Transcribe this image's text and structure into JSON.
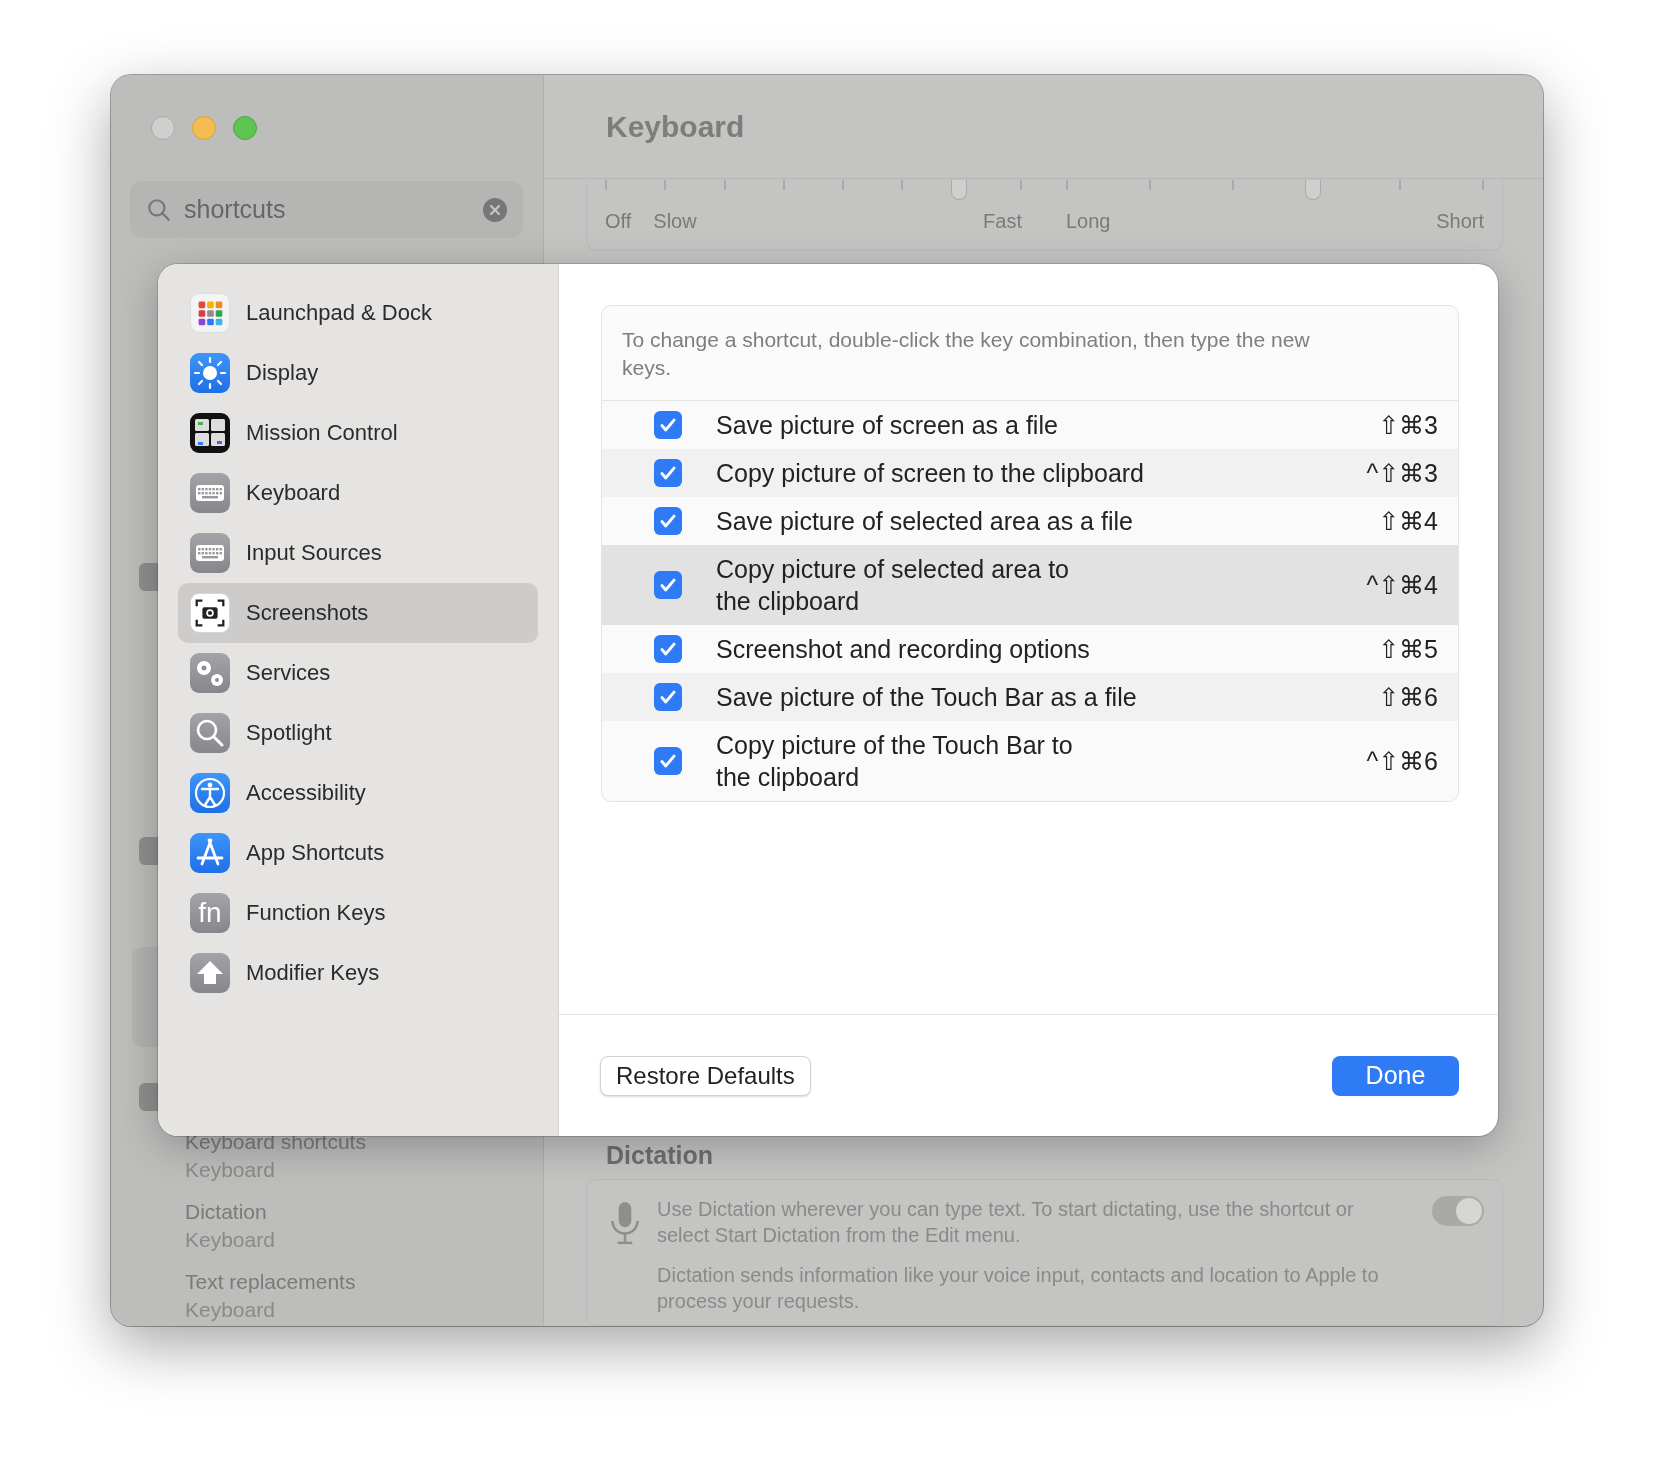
{
  "window": {
    "title": "Keyboard",
    "search": {
      "value": "shortcuts"
    },
    "sliders": [
      {
        "level": 0.85,
        "labels": [
          "Off",
          "Slow",
          "Fast"
        ]
      },
      {
        "level": 0.59,
        "labels": [
          "Long",
          "Short"
        ]
      }
    ],
    "results": [
      {
        "title": "Keyboard shortcuts",
        "subtitle": "Keyboard"
      },
      {
        "title": "Dictation",
        "subtitle": "Keyboard"
      },
      {
        "title": "Text replacements",
        "subtitle": "Keyboard"
      }
    ],
    "dictation": {
      "heading": "Dictation",
      "text": "Use Dictation wherever you can type text. To start dictating, use the shortcut or select Start Dictation from the Edit menu.",
      "note": "Dictation sends information like your voice input, contacts and location to Apple to process your requests.",
      "on": true
    }
  },
  "sheet": {
    "sidebar": [
      {
        "label": "Launchpad & Dock",
        "selected": false
      },
      {
        "label": "Display",
        "selected": false
      },
      {
        "label": "Mission Control",
        "selected": false
      },
      {
        "label": "Keyboard",
        "selected": false
      },
      {
        "label": "Input Sources",
        "selected": false
      },
      {
        "label": "Screenshots",
        "selected": true
      },
      {
        "label": "Services",
        "selected": false
      },
      {
        "label": "Spotlight",
        "selected": false
      },
      {
        "label": "Accessibility",
        "selected": false
      },
      {
        "label": "App Shortcuts",
        "selected": false
      },
      {
        "label": "Function Keys",
        "selected": false,
        "icon_text": "fn"
      },
      {
        "label": "Modifier Keys",
        "selected": false
      }
    ],
    "hint": "To change a shortcut, double-click the key combination, then type the new keys.",
    "shortcuts": [
      {
        "label": "Save picture of screen as a file",
        "keys": "⇧⌘3",
        "checked": true,
        "selected": false
      },
      {
        "label": "Copy picture of screen to the clipboard",
        "keys": "^⇧⌘3",
        "checked": true,
        "selected": false
      },
      {
        "label": "Save picture of selected area as a file",
        "keys": "⇧⌘4",
        "checked": true,
        "selected": false
      },
      {
        "label": "Copy picture of selected area to\nthe clipboard",
        "keys": "^⇧⌘4",
        "checked": true,
        "selected": true
      },
      {
        "label": "Screenshot and recording options",
        "keys": "⇧⌘5",
        "checked": true,
        "selected": false
      },
      {
        "label": "Save picture of the Touch Bar as a file",
        "keys": "⇧⌘6",
        "checked": true,
        "selected": false
      },
      {
        "label": "Copy picture of the Touch Bar to\nthe clipboard",
        "keys": "^⇧⌘6",
        "checked": true,
        "selected": false
      }
    ],
    "buttons": {
      "restore": "Restore Defaults",
      "done": "Done"
    }
  }
}
